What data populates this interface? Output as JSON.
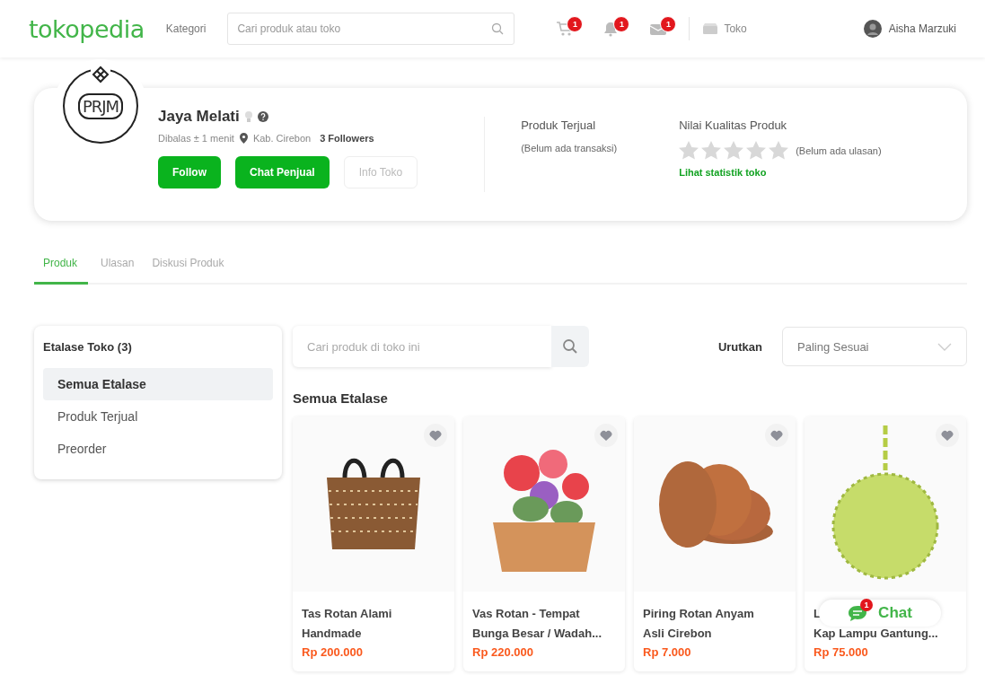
{
  "header": {
    "logo": "tokopedia",
    "category_link": "Kategori",
    "search": {
      "placeholder": "Cari produk atau toko"
    },
    "icons": [
      {
        "kind": "cart",
        "badge": "1"
      },
      {
        "kind": "bell",
        "badge": "1"
      },
      {
        "kind": "mail",
        "badge": "1"
      }
    ],
    "shop_link": "Toko",
    "user_name": "Aisha Marzuki"
  },
  "shop": {
    "logo_text": "PRJM",
    "name": "Jaya Melati",
    "response_time": "Dibalas ± 1 menit",
    "location": "Kab. Cirebon",
    "followers": "3 Followers",
    "buttons": [
      {
        "label": "Follow",
        "kind": "primary"
      },
      {
        "label": "Chat Penjual",
        "kind": "primary"
      },
      {
        "label": "Info Toko",
        "kind": "outline"
      }
    ],
    "sold": {
      "title": "Produk Terjual",
      "value": "(Belum ada transaksi)"
    },
    "quality": {
      "title": "Nilai Kualitas Produk",
      "stars": 0,
      "note": "(Belum ada ulasan)",
      "link": "Lihat statistik toko"
    }
  },
  "tabs": [
    {
      "label": "Produk",
      "selected": true
    },
    {
      "label": "Ulasan",
      "selected": false
    },
    {
      "label": "Diskusi Produk",
      "selected": false
    }
  ],
  "etalase": {
    "title": "Etalase Toko (3)",
    "items": [
      {
        "label": "Semua Etalase",
        "selected": true
      },
      {
        "label": "Produk Terjual",
        "selected": false
      },
      {
        "label": "Preorder",
        "selected": false
      }
    ]
  },
  "product_search": {
    "placeholder": "Cari produk di toko ini"
  },
  "sort": {
    "label": "Urutkan",
    "value": "Paling Sesuai"
  },
  "section_title": "Semua Etalase",
  "products": [
    {
      "kind": "bag",
      "name_lines": [
        "Tas Rotan Alami",
        "Handmade"
      ],
      "price": "Rp 200.000"
    },
    {
      "kind": "plant",
      "name_lines": [
        "Vas Rotan - Tempat",
        "Bunga Besar / Wadah..."
      ],
      "price": "Rp 220.000"
    },
    {
      "kind": "plates",
      "name_lines": [
        "Piring Rotan Anyam",
        "Asli Cirebon"
      ],
      "price": "Rp 7.000"
    },
    {
      "kind": "lamp",
      "name_lines": [
        "L",
        "Kap Lampu Gantung..."
      ],
      "price": "Rp 75.000"
    }
  ],
  "chat_button": {
    "label": "Chat",
    "badge": "1"
  }
}
